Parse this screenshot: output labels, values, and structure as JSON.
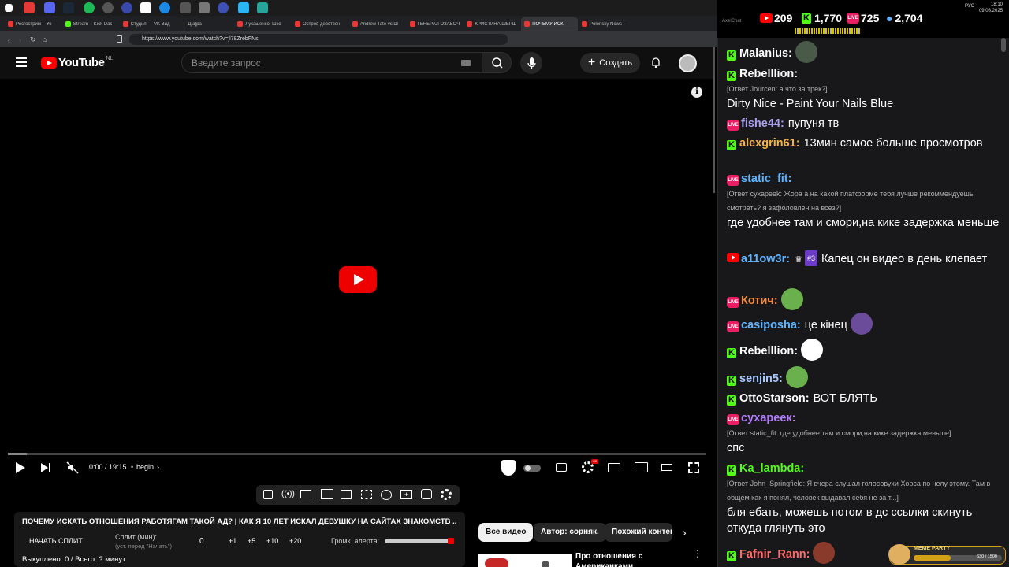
{
  "browser": {
    "tabs": [
      {
        "label": "Росгострим – Yo",
        "color": "#e53935"
      },
      {
        "label": "Stream – Kick Das",
        "color": "#53fc18"
      },
      {
        "label": "Студия — VK Вид",
        "color": "#e53935"
      },
      {
        "label": "Д[а]ра",
        "color": "#222"
      },
      {
        "label": "Лукашенко: Шко",
        "color": "#e53935"
      },
      {
        "label": "Остров девствен",
        "color": "#e53935"
      },
      {
        "label": "Andrew Tate vs Ш",
        "color": "#e53935"
      },
      {
        "label": "ГЕНЕРАЛ ОЗАБОЧ",
        "color": "#e53935"
      },
      {
        "label": "КРИСТИНА ШЕРШ",
        "color": "#e53935"
      },
      {
        "label": "ПОЧЕМУ ИСК",
        "color": "#e53935"
      },
      {
        "label": "Polonsky News -",
        "color": "#e53935"
      }
    ],
    "url": "https://www.youtube.com/watch?v=jl78ZrebFNs"
  },
  "youtube": {
    "logo": "YouTube",
    "region": "NL",
    "search_placeholder": "Введите запрос",
    "create_label": "Создать",
    "time": "0:00 / 19:15",
    "chapter": "begin",
    "video_title": "ПОЧЕМУ ИСКАТЬ ОТНОШЕНИЯ РАБОТЯГАМ ТАКОЙ АД? | КАК Я 10 ЛЕТ ИСКАЛ ДЕВУШКУ НА САЙТАХ ЗНАКОМСТВ ...",
    "split_button": "НАЧАТЬ СПЛИТ",
    "split_label": "Сплит (мин):",
    "split_hint": "(уст. перед \"Начать\")",
    "split_value": "0",
    "steps": [
      "+1",
      "+5",
      "+10",
      "+20"
    ],
    "alert_label": "Громк. алерта:",
    "alert_volume": 0.95,
    "bought": "Выкуплено: 0 / Всего: ? минут",
    "chips": [
      "Все видео",
      "Автор: сорняк.",
      "Похожий контен"
    ],
    "rec_title_1": "Про отношения с",
    "rec_title_2": "Американками ..."
  },
  "system": {
    "time": "18:10",
    "date": "09.08.2025",
    "lang": "РУС"
  },
  "chat": {
    "app_title": "AxelChat",
    "stats": {
      "youtube": "209",
      "kick": "1,770",
      "vk": "725",
      "total": "2,704"
    },
    "messages": [
      {
        "platform": "kick",
        "user": "Malanius:",
        "color": "#ffffff",
        "reply": "",
        "text": "",
        "emote": "#4a5a48"
      },
      {
        "platform": "kick",
        "user": "Rebelllion:",
        "color": "#ffffff",
        "reply": "[Ответ Jourcen: а что за трек?]",
        "text": "Dirty Nice - Paint Your Nails Blue"
      },
      {
        "platform": "vk",
        "user": "fishe44:",
        "color": "#a9a0f0",
        "reply": "",
        "text": "пупуня тв"
      },
      {
        "platform": "kick",
        "user": "alexgrin61:",
        "color": "#f5b342",
        "reply": "",
        "text": "13мин самое больше просмотров"
      },
      {
        "platform": "vk",
        "user": "static_fit:",
        "color": "#5fb4ff",
        "reply": "[Ответ сухарeek: Жора а на какой платформе тебя лучше рекоммендуешь смотреть? я зафоловлен на всез?]",
        "text": "где удобнее там и смори,на кике задержка меньше"
      },
      {
        "platform": "yt",
        "user": "a11ow3r:",
        "color": "#5fb4ff",
        "badge": "#3",
        "reply": "",
        "text": "Капец он видео в день клепает"
      },
      {
        "platform": "vk",
        "user": "Котич:",
        "color": "#f58a42",
        "reply": "",
        "text": "",
        "emote": "#6ab04c"
      },
      {
        "platform": "vk",
        "user": "casiposha:",
        "color": "#5fb4ff",
        "reply": "",
        "text": "це кінец",
        "emote": "#6b4c9a"
      },
      {
        "platform": "kick",
        "user": "Rebelllion:",
        "color": "#ffffff",
        "reply": "",
        "text": "",
        "emote": "#ffffff"
      },
      {
        "platform": "kick",
        "user": "senjin5:",
        "color": "#a9c8ff",
        "reply": "",
        "text": "",
        "emote": "#6ab04c"
      },
      {
        "platform": "kick",
        "user": "OttoStarson:",
        "color": "#ffffff",
        "reply": "",
        "text": "ВОТ БЛЯТЬ"
      },
      {
        "platform": "vk",
        "user": "cухареек:",
        "color": "#b47cff",
        "reply": "[Ответ static_fit: где удобнее там и смори,на кике задержка меньше]",
        "text": "спс"
      },
      {
        "platform": "kick",
        "user": "Ka_lambda:",
        "color": "#53fc18",
        "reply": "[Ответ John_Springfield: Я вчера слушал голосовухи Хорса по челу этому. Там в общем как я понял, человек выдавал себя не за т...]",
        "text": "бля ебать, можешь потом в дс ссылки скинуть откуда глянуть это"
      },
      {
        "platform": "kick",
        "user": "Fafnir_Rann:",
        "color": "#ff6a6a",
        "reply": "",
        "text": "",
        "emote": "#8a3a2a"
      }
    ],
    "meme_party_label": "MEME PARTY",
    "meme_party_progress": "630 / 1500"
  }
}
